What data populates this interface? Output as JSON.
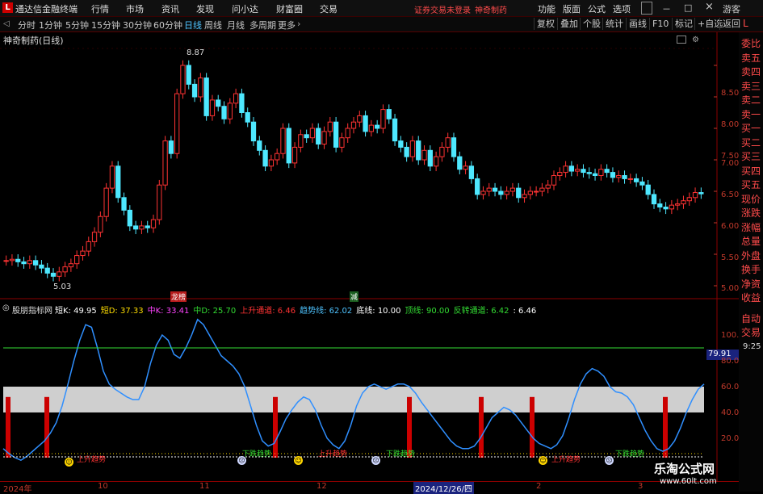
{
  "app": {
    "logo": "L",
    "title": "通达信金融终端",
    "warning": "证券交易未登录",
    "stock_tag": "神奇制药",
    "menus": [
      "行情",
      "市场",
      "资讯",
      "发现",
      "问小达",
      "财富圈",
      "交易"
    ],
    "right_menus": [
      "功能",
      "版面",
      "公式",
      "选项"
    ],
    "guest": "游客"
  },
  "timeframes": [
    "分时",
    "1分钟",
    "5分钟",
    "15分钟",
    "30分钟",
    "60分钟",
    "日线",
    "周线",
    "月线",
    "多周期",
    "更多"
  ],
  "active_timeframe": "日线",
  "toolbar_buttons": [
    "复权",
    "叠加",
    "个股",
    "统计",
    "画线",
    "F10",
    "标记",
    "+自选",
    "返回"
  ],
  "toolbar_icons": [
    "layout-icon",
    "screen-icon"
  ],
  "stock_title": "神奇制药(日线)",
  "sidebar_items": [
    "委比",
    "卖五",
    "卖四",
    "卖三",
    "卖二",
    "卖一",
    "买一",
    "买二",
    "买三",
    "买四",
    "买五",
    "现价",
    "涨跌",
    "涨幅",
    "总量",
    "外盘",
    "换手",
    "净资",
    "收益"
  ],
  "sidebar_extra": {
    "auto_trade": "自动",
    "trade": "交易",
    "time": "9:25"
  },
  "price_axis": [
    "8.50",
    "8.00",
    "7.50",
    "7.00",
    "6.50",
    "6.00",
    "5.50",
    "5.00"
  ],
  "price_high_label": "8.87",
  "price_low_label": "5.03",
  "markers": {
    "dragon_tiger": "龙榜",
    "reduce": "减"
  },
  "indicator": {
    "name": "股朋指标网",
    "values": [
      {
        "label": "短K",
        "value": "49.95",
        "color": "#ffffff"
      },
      {
        "label": "短D",
        "value": "37.33",
        "color": "#ffdd00"
      },
      {
        "label": "中K",
        "value": "33.41",
        "color": "#ff44ff"
      },
      {
        "label": "中D",
        "value": "25.70",
        "color": "#33dd33"
      },
      {
        "label": "上升通道",
        "value": "6.46",
        "color": "#ff3333"
      },
      {
        "label": "趋势线",
        "value": "62.02",
        "color": "#4ec3ff"
      },
      {
        "label": "底线",
        "value": "10.00",
        "color": "#ffffff"
      },
      {
        "label": "顶线",
        "value": "90.00",
        "color": "#33dd33"
      },
      {
        "label": "反转通道",
        "value": "6.42",
        "color": "#33dd33"
      },
      {
        "label": "",
        "value": "6.46",
        "color": "#ffffff"
      }
    ],
    "axis": [
      "100.0",
      "80.00",
      "60.00",
      "40.00",
      "20.00"
    ],
    "current_value": "79.91",
    "signals_down": [
      "下跌趋势",
      "下跌趋势",
      "下跌趋势",
      "下跌趋势"
    ],
    "signals_up": [
      "上升趋势",
      "上升趋势",
      "上升趋势",
      "上升趋势"
    ],
    "trend_values": [
      12,
      8,
      5,
      3,
      6,
      10,
      14,
      18,
      24,
      32,
      45,
      62,
      80,
      96,
      108,
      106,
      90,
      72,
      62,
      58,
      55,
      52,
      50,
      50,
      60,
      78,
      92,
      100,
      96,
      85,
      82,
      90,
      100,
      112,
      108,
      100,
      92,
      84,
      80,
      76,
      70,
      60,
      45,
      30,
      18,
      14,
      16,
      25,
      35,
      42,
      48,
      52,
      50,
      42,
      30,
      20,
      15,
      12,
      18,
      30,
      45,
      55,
      60,
      62,
      60,
      58,
      60,
      62,
      62,
      60,
      55,
      48,
      42,
      36,
      30,
      24,
      18,
      14,
      12,
      12,
      14,
      20,
      28,
      36,
      40,
      44,
      42,
      38,
      32,
      26,
      20,
      16,
      14,
      12,
      15,
      22,
      35,
      50,
      62,
      70,
      74,
      72,
      68,
      60,
      56,
      55,
      52,
      46,
      36,
      26,
      18,
      12,
      10,
      12,
      18,
      28,
      40,
      50,
      58,
      62
    ]
  },
  "x_axis": [
    "2024年",
    "10",
    "11",
    "12",
    "2024/12/26/四",
    "2",
    "3"
  ],
  "watermark": {
    "site": "乐淘公式网",
    "url": "www.60lt.com"
  },
  "colors": {
    "up": "#ff3333",
    "down": "#4ee8ff",
    "trend": "#2f8fff",
    "band": "#cfcfcf",
    "top_line": "#33dd33",
    "bar_signal": "#cc0000"
  }
}
